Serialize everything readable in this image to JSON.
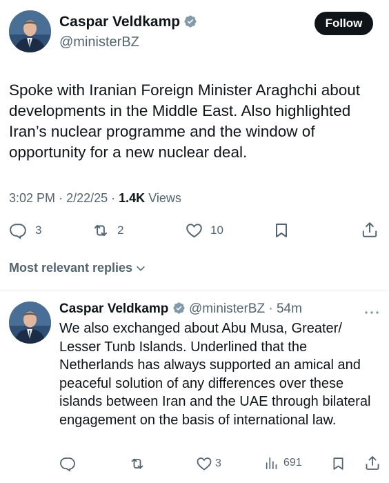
{
  "tweet": {
    "author_name": "Caspar Veldkamp",
    "author_handle": "@ministerBZ",
    "follow_label": "Follow",
    "text": "Spoke with Iranian Foreign Minister Araghchi about developments in the Middle East. Also highlighted Iran’s nuclear programme and the window of opportunity for a new nuclear deal.",
    "time": "3:02 PM",
    "date": "2/22/25",
    "views_count": "1.4K",
    "views_label": "Views",
    "replies": "3",
    "reposts": "2",
    "likes": "10"
  },
  "replies_header": "Most relevant replies",
  "reply": {
    "author_name": "Caspar Veldkamp",
    "author_handle": "@ministerBZ",
    "age": "54m",
    "text": "We also exchanged about Abu Musa, Greater/ Lesser Tunb Islands. Underlined that the Netherlands has always supported an amical and peaceful solution of any differences over these islands between Iran and the UAE through bilateral engagement on the basis of international law.",
    "likes": "3",
    "views": "691"
  },
  "colors": {
    "verified": "#829aab",
    "text": "#0f1419",
    "muted": "#536471"
  }
}
